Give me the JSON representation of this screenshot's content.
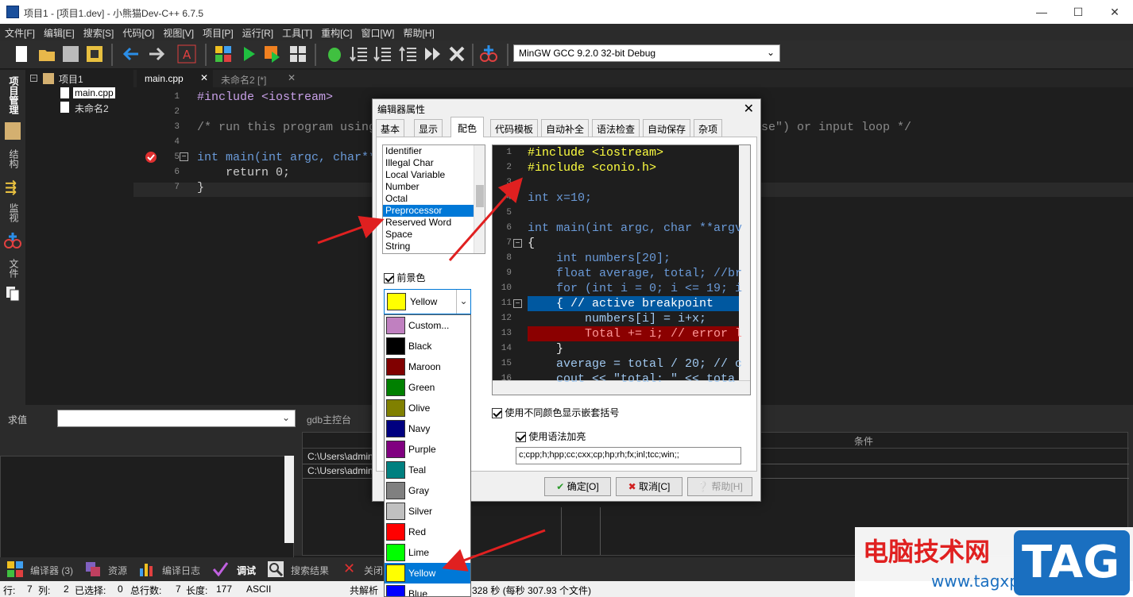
{
  "titlebar": {
    "title": "项目1 - [项目1.dev] - 小熊猫Dev-C++ 6.7.5",
    "minimize": "—",
    "maximize": "☐",
    "close": "✕"
  },
  "menu": [
    "文件[F]",
    "编辑[E]",
    "搜索[S]",
    "代码[O]",
    "视图[V]",
    "项目[P]",
    "运行[R]",
    "工具[T]",
    "重构[C]",
    "窗口[W]",
    "帮助[H]"
  ],
  "toolbar": {
    "compiler": "MinGW GCC 9.2.0 32-bit Debug"
  },
  "vtabs": [
    "项目管理",
    "结构",
    "监视",
    "文件"
  ],
  "tree": {
    "project": "项目1",
    "files": [
      "main.cpp",
      "未命名2"
    ]
  },
  "editor": {
    "tabs": [
      "main.cpp",
      "未命名2 [*]"
    ],
    "lines": [
      {
        "n": "1",
        "t": "#include <iostream>"
      },
      {
        "n": "2",
        "t": ""
      },
      {
        "n": "3",
        "t": "/* run this program using"
      },
      {
        "n": "4",
        "t": ""
      },
      {
        "n": "5",
        "t": "int main(int argc, char**"
      },
      {
        "n": "6",
        "t": "    return 0;"
      },
      {
        "n": "7",
        "t": "}"
      }
    ],
    "tail3": "se\") or input loop */"
  },
  "bottom": {
    "eval_label": "求值",
    "gdb_label": "gdb主控台",
    "cond_label": "条件",
    "paths": [
      "C:\\Users\\admin",
      "C:\\Users\\admin"
    ]
  },
  "bottomtabs": [
    "编译器 (3)",
    "资源",
    "编译日志",
    "调试",
    "搜索结果",
    "关闭"
  ],
  "status": {
    "row_label": "行:",
    "row": "7",
    "col_label": "列:",
    "col": "2",
    "sel_label": "已选择:",
    "sel": "0",
    "total_label": "总行数:",
    "total": "7",
    "len_label": "长度:",
    "len": "177",
    "enc": "ASCII",
    "parse": "共解析",
    "parse_tail": "328 秒 (每秒 307.93 个文件)"
  },
  "dialog": {
    "title": "编辑器属性",
    "tabs": [
      "基本",
      "显示",
      "配色",
      "代码模板",
      "自动补全",
      "语法检查",
      "自动保存",
      "杂项"
    ],
    "elements": [
      "Identifier",
      "Illegal Char",
      "Local Variable",
      "Number",
      "Octal",
      "Preprocessor",
      "Reserved Word",
      "Space",
      "String"
    ],
    "selected_element": "Preprocessor",
    "fg_label": "前景色",
    "fg_value": "Yellow",
    "preview": [
      {
        "n": "1",
        "t": "#include <iostream>"
      },
      {
        "n": "2",
        "t": "#include <conio.h>"
      },
      {
        "n": "3",
        "t": ""
      },
      {
        "n": "4",
        "t": "int x=10;"
      },
      {
        "n": "5",
        "t": ""
      },
      {
        "n": "6",
        "t": "int main(int argc, char **argv"
      },
      {
        "n": "7",
        "t": "{"
      },
      {
        "n": "8",
        "t": "    int numbers[20];"
      },
      {
        "n": "9",
        "t": "    float average, total; //br"
      },
      {
        "n": "10",
        "t": "    for (int i = 0; i <= 19; i"
      },
      {
        "n": "11",
        "t": "    { // active breakpoint"
      },
      {
        "n": "12",
        "t": "        numbers[i] = i+x;"
      },
      {
        "n": "13",
        "t": "        Total += i; // error l"
      },
      {
        "n": "14",
        "t": "    }"
      },
      {
        "n": "15",
        "t": "    average = total / 20; // c"
      },
      {
        "n": "16",
        "t": "    cout << \"total: \" << tota"
      }
    ],
    "opt_brackets": "使用不同颜色显示嵌套括号",
    "opt_syntax": "使用语法加亮",
    "extensions": "c;cpp;h;hpp;cc;cxx;cp;hp;rh;fx;inl;tcc;win;;",
    "ok": "确定[O]",
    "cancel": "取消[C]",
    "help": "帮助[H]"
  },
  "colors": [
    {
      "name": "Custom...",
      "hex": "#c080c0"
    },
    {
      "name": "Black",
      "hex": "#000000"
    },
    {
      "name": "Maroon",
      "hex": "#800000"
    },
    {
      "name": "Green",
      "hex": "#008000"
    },
    {
      "name": "Olive",
      "hex": "#808000"
    },
    {
      "name": "Navy",
      "hex": "#000080"
    },
    {
      "name": "Purple",
      "hex": "#800080"
    },
    {
      "name": "Teal",
      "hex": "#008080"
    },
    {
      "name": "Gray",
      "hex": "#808080"
    },
    {
      "name": "Silver",
      "hex": "#c0c0c0"
    },
    {
      "name": "Red",
      "hex": "#ff0000"
    },
    {
      "name": "Lime",
      "hex": "#00ff00"
    },
    {
      "name": "Yellow",
      "hex": "#ffff00"
    },
    {
      "name": "Blue",
      "hex": "#0000ff"
    }
  ],
  "watermark": {
    "text": "电脑技术网",
    "url": "www.tagxp.com",
    "logo": "TAG"
  }
}
